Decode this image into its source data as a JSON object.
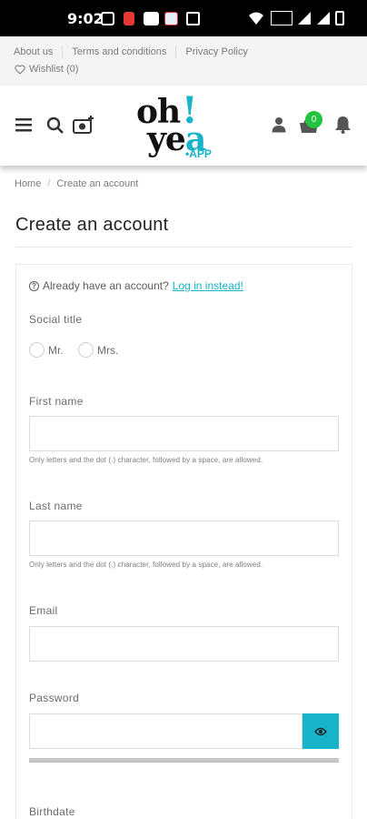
{
  "status_bar": {
    "time": "9:02"
  },
  "top_links": {
    "about": "About us",
    "terms": "Terms and conditions",
    "privacy": "Privacy Policy",
    "wishlist": "Wishlist (0)"
  },
  "header": {
    "logo_oh": "oh",
    "logo_bang": "!",
    "logo_ye": "ye",
    "logo_a": "a",
    "logo_app": "•APP",
    "cart_count": "0"
  },
  "breadcrumb": {
    "home": "Home",
    "separator": "/",
    "current": "Create an account"
  },
  "page_title": "Create an account",
  "form": {
    "login_prompt": "Already have an account?",
    "login_link": "Log in instead!",
    "social_title_label": "Social title",
    "social_options": [
      "Mr.",
      "Mrs."
    ],
    "first_name_label": "First name",
    "first_name_value": "",
    "first_name_hint": "Only letters and the dot (.) character, followed by a space, are allowed.",
    "last_name_label": "Last name",
    "last_name_value": "",
    "last_name_hint": "Only letters and the dot (.) character, followed by a space, are allowed.",
    "email_label": "Email",
    "email_value": "",
    "password_label": "Password",
    "password_value": "",
    "birthdate_label": "Birthdate"
  },
  "colors": {
    "accent": "#17b3c8",
    "badge": "#22c33e",
    "text": "#232323"
  },
  "icons": [
    "menu-icon",
    "search-icon",
    "camera-icon",
    "user-icon",
    "cart-icon",
    "bell-icon",
    "heart-icon",
    "eye-icon"
  ]
}
